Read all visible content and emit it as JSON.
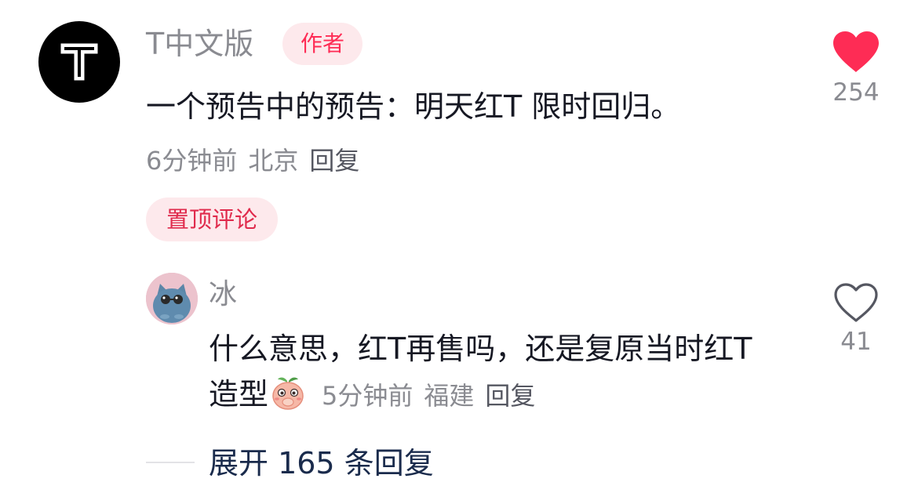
{
  "comment": {
    "author_name": "T中文版",
    "author_badge": "作者",
    "text": "一个预告中的预告：明天红T 限时回归。",
    "time": "6分钟前",
    "location": "北京",
    "reply_label": "回复",
    "pinned_label": "置顶评论",
    "like_count": "254",
    "liked": true,
    "avatar_letter": "T"
  },
  "reply": {
    "author_name": "冰",
    "text": "什么意思，红T再售吗，还是复原当时红T造型",
    "emoji_icon": "peach-face-emoji-icon",
    "time": "5分钟前",
    "location": "福建",
    "reply_label": "回复",
    "like_count": "41",
    "liked": false
  },
  "expand": {
    "label": "展开 165 条回复"
  },
  "colors": {
    "accent": "#fe2c55",
    "muted_text": "#8a8b91",
    "primary_text": "#161823",
    "badge_bg": "#fde9ec"
  }
}
